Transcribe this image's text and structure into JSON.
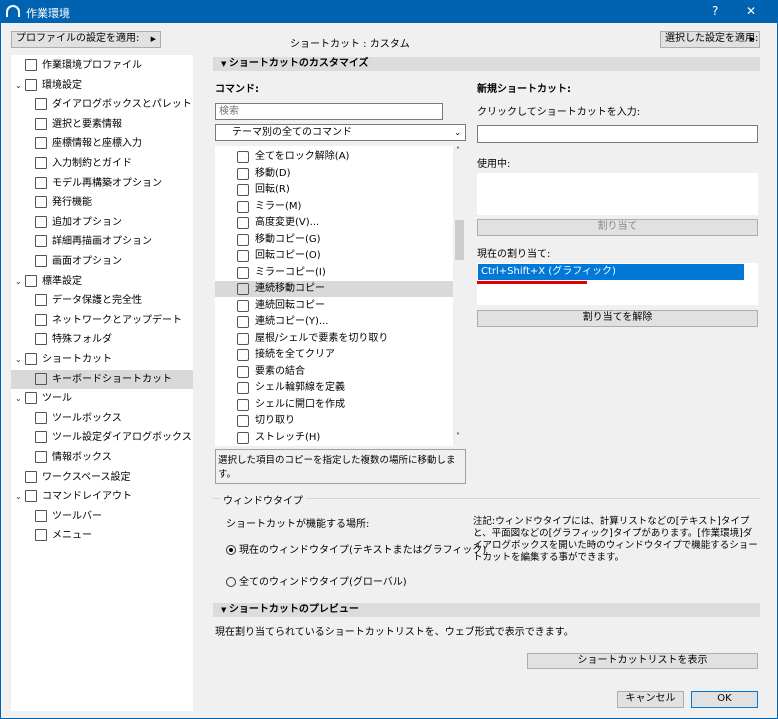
{
  "window": {
    "title": "作業環境",
    "help": "?",
    "close": "✕"
  },
  "header": {
    "apply_profile": "プロファイルの設定を適用:",
    "shortcut_status": "ショートカット : カスタム",
    "apply_selected": "選択した設定を適用:"
  },
  "tree": [
    {
      "label": "作業環境プロファイル",
      "level": 0,
      "expand": false
    },
    {
      "label": "環境設定",
      "level": 0,
      "expand": true
    },
    {
      "label": "ダイアログボックスとパレット",
      "level": 1
    },
    {
      "label": "選択と要素情報",
      "level": 1
    },
    {
      "label": "座標情報と座標入力",
      "level": 1
    },
    {
      "label": "入力制約とガイド",
      "level": 1
    },
    {
      "label": "モデル再構築オプション",
      "level": 1
    },
    {
      "label": "発行機能",
      "level": 1
    },
    {
      "label": "追加オプション",
      "level": 1
    },
    {
      "label": "詳細再描画オプション",
      "level": 1
    },
    {
      "label": "画面オプション",
      "level": 1
    },
    {
      "label": "標準設定",
      "level": 0,
      "expand": true
    },
    {
      "label": "データ保護と完全性",
      "level": 1
    },
    {
      "label": "ネットワークとアップデート",
      "level": 1
    },
    {
      "label": "特殊フォルダ",
      "level": 1
    },
    {
      "label": "ショートカット",
      "level": 0,
      "expand": true
    },
    {
      "label": "キーボードショートカット",
      "level": 1,
      "selected": true
    },
    {
      "label": "ツール",
      "level": 0,
      "expand": true
    },
    {
      "label": "ツールボックス",
      "level": 1
    },
    {
      "label": "ツール設定ダイアログボックス",
      "level": 1
    },
    {
      "label": "情報ボックス",
      "level": 1
    },
    {
      "label": "ワークスペース設定",
      "level": 0,
      "expand": false
    },
    {
      "label": "コマンドレイアウト",
      "level": 0,
      "expand": true
    },
    {
      "label": "ツールバー",
      "level": 1
    },
    {
      "label": "メニュー",
      "level": 1
    }
  ],
  "customize": {
    "section": "ショートカットのカスタマイズ",
    "command_label": "コマンド:",
    "search_placeholder": "検索",
    "filter": "テーマ別の全てのコマンド",
    "commands": [
      "全てをロック解除(A)",
      "移動(D)",
      "回転(R)",
      "ミラー(M)",
      "高度変更(V)...",
      "移動コピー(G)",
      "回転コピー(O)",
      "ミラーコピー(I)",
      "連続移動コピー",
      "連続回転コピー",
      "連続コピー(Y)...",
      "屋根/シェルで要素を切り取り",
      "接続を全てクリア",
      "要素の結合",
      "シェル輪郭線を定義",
      "シェルに開口を作成",
      "切り取り",
      "ストレッチ(H)"
    ],
    "selected_command": "連続移動コピー",
    "description": "選択した項目のコピーを指定した複数の場所に移動します。",
    "new_shortcut_label": "新規ショートカット:",
    "click_to_enter": "クリックしてショートカットを入力:",
    "new_shortcut_value": "",
    "in_use_label": "使用中:",
    "assign": "割り当て",
    "current_label": "現在の割り当て:",
    "current_items": [
      "Ctrl+Shift+X (グラフィック)"
    ],
    "unassign": "割り当てを解除"
  },
  "window_type": {
    "group": "ウィンドウタイプ",
    "where_label": "ショートカットが機能する場所:",
    "option_current": "現在のウィンドウタイプ(テキストまたはグラフィック)",
    "option_all": "全てのウィンドウタイプ(グローバル)",
    "selected": "current",
    "note": "注記:ウィンドウタイプには、計算リストなどの[テキスト]タイプと、平面図などの[グラフィック]タイプがあります。[作業環境]ダイアログボックスを開いた時のウィンドウタイプで機能するショートカットを編集する事ができます。"
  },
  "preview": {
    "section": "ショートカットのプレビュー",
    "text": "現在割り当てられているショートカットリストを、ウェブ形式で表示できます。",
    "show_button": "ショートカットリストを表示"
  },
  "footer": {
    "cancel": "キャンセル",
    "ok": "OK"
  },
  "colors": {
    "titlebar": "#0063b1",
    "selection": "#0078d7",
    "underline": "#e00000"
  }
}
